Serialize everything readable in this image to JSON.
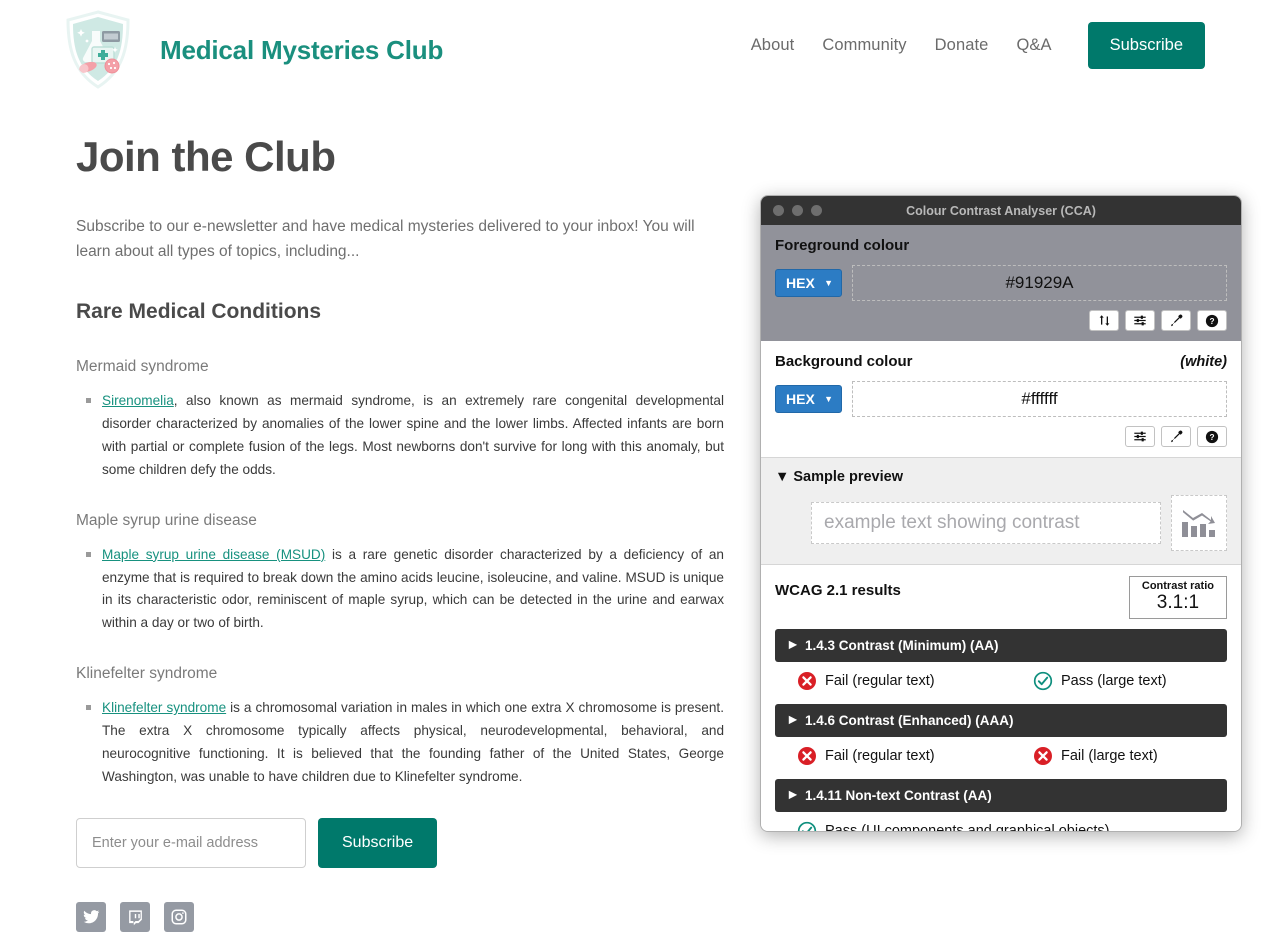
{
  "header": {
    "logo_icon": "shield-lab-badge-icon",
    "brand_title": "Medical Mysteries Club",
    "nav": [
      {
        "label": "About"
      },
      {
        "label": "Community"
      },
      {
        "label": "Donate"
      },
      {
        "label": "Q&A"
      }
    ],
    "subscribe_label": "Subscribe",
    "accent_color": "#00796b",
    "brand_color": "#1a8f7e"
  },
  "main": {
    "page_title": "Join the Club",
    "intro": "Subscribe to our e-newsletter and have medical mysteries delivered to your inbox! You will learn about all types of topics, including...",
    "section_title": "Rare Medical Conditions",
    "conditions": [
      {
        "heading": "Mermaid syndrome",
        "link_text": "Sirenomelia",
        "body": ", also known as mermaid syndrome, is an extremely rare congenital developmental disorder characterized by anomalies of the lower spine and the lower limbs. Affected infants are born with partial or complete fusion of the legs. Most newborns don't survive for long with this anomaly, but some children defy the odds."
      },
      {
        "heading": "Maple syrup urine disease",
        "link_text": "Maple syrup urine disease (MSUD)",
        "body": " is a rare genetic disorder characterized by a deficiency of an enzyme that is required to break down the amino acids leucine, isoleucine, and valine. MSUD is unique in its characteristic odor, reminiscent of maple syrup, which can be detected in the urine and earwax within a day or two of birth."
      },
      {
        "heading": "Klinefelter syndrome",
        "link_text": "Klinefelter syndrome",
        "body": " is a chromosomal variation in males in which one extra X chromosome is present. The extra X chromosome typically affects physical, neurodevelopmental, behavioral, and neurocognitive functioning. It is believed that the founding father of the United States, George Washington, was unable to have children due to Klinefelter syndrome."
      }
    ],
    "form": {
      "email_placeholder": "Enter your e-mail address",
      "email_value": "",
      "submit_label": "Subscribe"
    },
    "social": [
      {
        "name": "twitter-icon"
      },
      {
        "name": "twitch-icon"
      },
      {
        "name": "instagram-icon"
      }
    ]
  },
  "cca": {
    "window_title": "Colour Contrast Analyser (CCA)",
    "foreground": {
      "label": "Foreground colour",
      "format": "HEX",
      "value": "#91929A",
      "buttons": [
        "swap-colours-icon",
        "sliders-icon",
        "eyedropper-icon",
        "help-icon"
      ]
    },
    "background": {
      "label": "Background colour",
      "note": "(white)",
      "format": "HEX",
      "value": "#ffffff",
      "buttons": [
        "sliders-icon",
        "eyedropper-icon",
        "help-icon"
      ]
    },
    "preview": {
      "heading": "Sample preview",
      "sample_text": "example text showing contrast",
      "chart_icon": "declining-bar-chart-icon"
    },
    "wcag": {
      "title": "WCAG 2.1 results",
      "ratio_label": "Contrast ratio",
      "ratio_value": "3.1:1",
      "groups": [
        {
          "title": "1.4.3 Contrast (Minimum) (AA)",
          "results": [
            {
              "status": "fail",
              "label": "Fail (regular text)"
            },
            {
              "status": "pass",
              "label": "Pass (large text)"
            }
          ]
        },
        {
          "title": "1.4.6 Contrast (Enhanced) (AAA)",
          "results": [
            {
              "status": "fail",
              "label": "Fail (regular text)"
            },
            {
              "status": "fail",
              "label": "Fail (large text)"
            }
          ]
        },
        {
          "title": "1.4.11 Non-text Contrast (AA)",
          "results": [
            {
              "status": "pass",
              "label": "Pass (UI components and graphical objects)"
            }
          ]
        }
      ],
      "fail_color": "#d91f26",
      "pass_color": "#0f8f7e"
    }
  }
}
